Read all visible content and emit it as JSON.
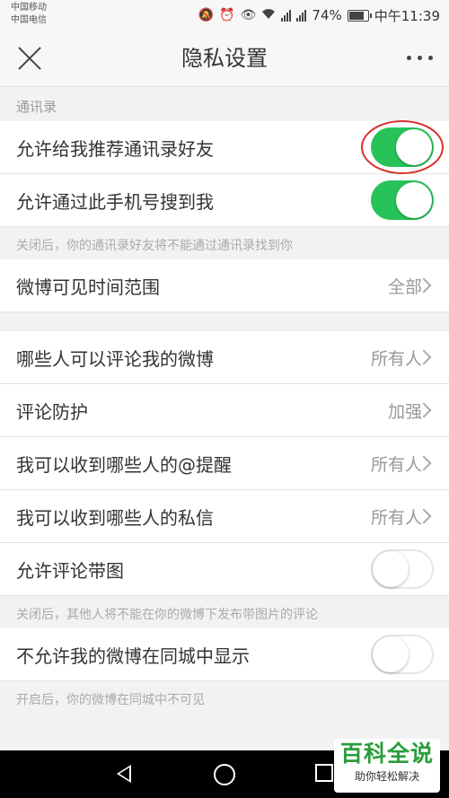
{
  "status_bar": {
    "carrier_1": "中国移动",
    "carrier_2": "中国电信",
    "battery": "74%",
    "time": "中午11:39",
    "icons": [
      "mute-icon",
      "alarm-icon",
      "eye-icon",
      "wifi-icon",
      "signal-icon",
      "battery-icon"
    ]
  },
  "header": {
    "title": "隐私设置",
    "close_icon": "close-icon",
    "more_icon": "more-icon"
  },
  "sections": {
    "contacts_header": "通讯录",
    "recommend_contacts": {
      "label": "允许给我推荐通讯录好友",
      "enabled": true
    },
    "search_by_phone": {
      "label": "允许通过此手机号搜到我",
      "enabled": true
    },
    "contacts_hint": "关闭后，你的通讯录好友将不能通过通讯录找到你",
    "weibo_visible_range": {
      "label": "微博可见时间范围",
      "value": "全部"
    },
    "who_can_comment": {
      "label": "哪些人可以评论我的微博",
      "value": "所有人"
    },
    "comment_protection": {
      "label": "评论防护",
      "value": "加强"
    },
    "mention_from": {
      "label": "我可以收到哪些人的@提醒",
      "value": "所有人"
    },
    "messages_from": {
      "label": "我可以收到哪些人的私信",
      "value": "所有人"
    },
    "comment_with_image": {
      "label": "允许评论带图",
      "enabled": false
    },
    "comment_image_hint": "关闭后，其他人将不能在你的微博下发布带图片的评论",
    "hide_in_city": {
      "label": "不允许我的微博在同城中显示",
      "enabled": false
    },
    "city_hint": "开启后，你的微博在同城中不可见"
  },
  "colors": {
    "toggle_on": "#27c358",
    "highlight": "#d9302c",
    "watermark": "#2a9d3a"
  },
  "watermark": {
    "title": "百科全说",
    "subtitle": "助你轻松解决"
  }
}
